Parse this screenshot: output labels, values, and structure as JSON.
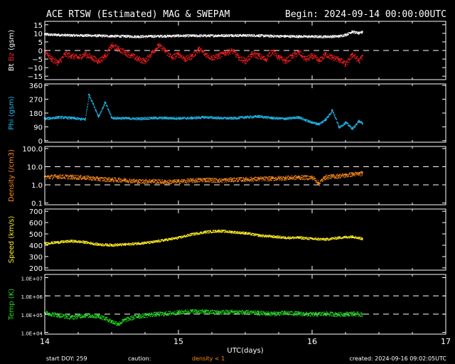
{
  "header": {
    "title": "ACE RTSW (Estimated) MAG & SWEPAM",
    "begin": "Begin: 2024-09-14 00:00:00UTC"
  },
  "footer": {
    "start_doy": "start DOY: 259",
    "caution": "caution:",
    "density_note": "density < 1",
    "created": "created: 2024-09-16 09:02:05UTC"
  },
  "colors": {
    "background": "#000000",
    "frame": "#ffffff",
    "bt": "#ffffff",
    "bz": "#ff2020",
    "phi": "#22bbee",
    "density": "#ff8c1a",
    "speed": "#ffee22",
    "temp": "#22dd22",
    "caution": "#ff8c1a"
  },
  "chart_data": {
    "type": "scatter",
    "x_label": "UTC(days)",
    "x_ticks": [
      "14",
      "15",
      "16",
      "17"
    ],
    "xlim": [
      14,
      17
    ],
    "data_end_day": 16.375,
    "panels": [
      {
        "id": "magfield",
        "ylabel_parts": [
          "Bt",
          "Bz",
          "(gsm)"
        ],
        "scale": "linear",
        "ylim": [
          -17,
          17
        ],
        "ticks": [
          -15,
          -10,
          -5,
          0,
          5,
          10,
          15
        ],
        "tick_labels": [
          "−15",
          "−10",
          "−5",
          "0",
          "5",
          "10",
          "15"
        ],
        "dashed": [
          0
        ],
        "series": [
          {
            "name": "Bt",
            "color": "#ffffff",
            "x": [
              14.0,
              14.1,
              14.2,
              14.3,
              14.4,
              14.5,
              14.6,
              14.7,
              14.8,
              14.9,
              15.0,
              15.1,
              15.2,
              15.3,
              15.4,
              15.5,
              15.6,
              15.7,
              15.8,
              15.9,
              16.0,
              16.1,
              16.2,
              16.25,
              16.3,
              16.35,
              16.375
            ],
            "y": [
              9.5,
              9.3,
              9.0,
              9.0,
              8.8,
              8.6,
              8.5,
              8.3,
              8.5,
              8.6,
              8.8,
              8.8,
              8.8,
              8.9,
              9.0,
              9.0,
              8.9,
              8.6,
              8.5,
              8.4,
              8.3,
              8.3,
              8.5,
              9.4,
              11.2,
              10.2,
              11.0
            ]
          },
          {
            "name": "Bz",
            "color": "#ff2020",
            "x": [
              14.0,
              14.05,
              14.1,
              14.15,
              14.2,
              14.25,
              14.3,
              14.35,
              14.4,
              14.45,
              14.5,
              14.55,
              14.6,
              14.65,
              14.7,
              14.75,
              14.8,
              14.85,
              14.9,
              14.95,
              15.0,
              15.05,
              15.1,
              15.15,
              15.2,
              15.25,
              15.3,
              15.35,
              15.4,
              15.45,
              15.5,
              15.55,
              15.6,
              15.65,
              15.7,
              15.75,
              15.8,
              15.85,
              15.9,
              15.95,
              16.0,
              16.05,
              16.1,
              16.15,
              16.2,
              16.25,
              16.3,
              16.35,
              16.375
            ],
            "y": [
              0,
              -5,
              -7,
              -2,
              -3,
              -4,
              -2,
              -4,
              -6,
              -3,
              3,
              1,
              -1,
              -3,
              -5,
              -6,
              -1,
              3,
              0,
              -4,
              -2,
              -5,
              -3,
              1,
              -2,
              -4,
              -3,
              -1,
              0,
              -4,
              -6,
              -2,
              -3,
              -5,
              0,
              -4,
              -6,
              -3,
              -1,
              -5,
              -3,
              -6,
              -2,
              -4,
              -5,
              -8,
              -2,
              -6,
              -3
            ]
          }
        ]
      },
      {
        "id": "phi",
        "ylabel": "Phi (gsm)",
        "scale": "linear",
        "ylim": [
          -10,
          370
        ],
        "ticks": [
          0,
          90,
          180,
          270,
          360
        ],
        "tick_labels": [
          "0",
          "90",
          "180",
          "270",
          "360"
        ],
        "series": [
          {
            "name": "Phi",
            "color": "#22bbee",
            "x": [
              14.0,
              14.1,
              14.2,
              14.3,
              14.33,
              14.4,
              14.45,
              14.5,
              14.6,
              14.7,
              14.8,
              14.9,
              15.0,
              15.1,
              15.2,
              15.3,
              15.4,
              15.5,
              15.6,
              15.7,
              15.8,
              15.9,
              15.95,
              16.0,
              16.05,
              16.1,
              16.15,
              16.2,
              16.25,
              16.3,
              16.35,
              16.375
            ],
            "y": [
              145,
              155,
              150,
              140,
              300,
              160,
              250,
              150,
              148,
              145,
              150,
              150,
              148,
              150,
              155,
              150,
              148,
              155,
              160,
              150,
              145,
              155,
              135,
              120,
              110,
              140,
              200,
              90,
              120,
              80,
              130,
              115
            ]
          }
        ]
      },
      {
        "id": "density",
        "ylabel": "Density (/cm3)",
        "scale": "log",
        "ylim": [
          0.08,
          130
        ],
        "ticks": [
          0.1,
          1.0,
          10.0,
          100.0
        ],
        "tick_labels": [
          "0.1",
          "1.0",
          "10.0",
          "100.0"
        ],
        "dashed": [
          1.0,
          10.0
        ],
        "series": [
          {
            "name": "Density",
            "color": "#ff8c1a",
            "x": [
              14.0,
              14.1,
              14.2,
              14.3,
              14.4,
              14.5,
              14.6,
              14.7,
              14.8,
              14.9,
              15.0,
              15.1,
              15.2,
              15.3,
              15.4,
              15.5,
              15.6,
              15.7,
              15.8,
              15.9,
              16.0,
              16.05,
              16.1,
              16.15,
              16.2,
              16.25,
              16.3,
              16.35,
              16.375
            ],
            "y": [
              2.8,
              3.0,
              2.8,
              2.6,
              2.2,
              2.0,
              1.9,
              1.6,
              1.7,
              1.5,
              1.6,
              1.8,
              2.0,
              1.8,
              2.0,
              2.1,
              2.2,
              2.3,
              2.5,
              2.7,
              2.6,
              1.2,
              2.8,
              3.0,
              3.2,
              3.5,
              4.0,
              4.2,
              4.5
            ]
          }
        ]
      },
      {
        "id": "speed",
        "ylabel": "Speed (km/s)",
        "scale": "linear",
        "ylim": [
          180,
          720
        ],
        "ticks": [
          200,
          300,
          400,
          500,
          600,
          700
        ],
        "tick_labels": [
          "200",
          "300",
          "400",
          "500",
          "600",
          "700"
        ],
        "series": [
          {
            "name": "Speed",
            "color": "#ffee22",
            "x": [
              14.0,
              14.1,
              14.2,
              14.3,
              14.4,
              14.5,
              14.6,
              14.7,
              14.8,
              14.9,
              15.0,
              15.1,
              15.2,
              15.3,
              15.4,
              15.5,
              15.6,
              15.7,
              15.8,
              15.9,
              16.0,
              16.1,
              16.2,
              16.3,
              16.375
            ],
            "y": [
              420,
              430,
              440,
              430,
              410,
              405,
              410,
              420,
              430,
              450,
              470,
              500,
              520,
              530,
              520,
              510,
              490,
              480,
              470,
              470,
              460,
              455,
              470,
              480,
              460
            ]
          }
        ]
      },
      {
        "id": "temp",
        "ylabel": "Temp (K)",
        "scale": "log",
        "ylim": [
          8000,
          15000000
        ],
        "ticks": [
          10000,
          100000,
          1000000,
          10000000
        ],
        "tick_labels": [
          "1.0E+04",
          "1.0E+05",
          "1.0E+06",
          "1.0E+07"
        ],
        "dashed": [
          100000,
          1000000
        ],
        "series": [
          {
            "name": "Temp",
            "color": "#22dd22",
            "x": [
              14.0,
              14.1,
              14.2,
              14.3,
              14.4,
              14.5,
              14.55,
              14.6,
              14.7,
              14.8,
              14.9,
              15.0,
              15.1,
              15.2,
              15.3,
              15.4,
              15.5,
              15.6,
              15.7,
              15.8,
              15.9,
              16.0,
              16.1,
              16.2,
              16.3,
              16.375
            ],
            "y": [
              120000,
              90000,
              70000,
              90000,
              80000,
              40000,
              30000,
              50000,
              80000,
              100000,
              110000,
              130000,
              150000,
              140000,
              130000,
              140000,
              130000,
              120000,
              110000,
              120000,
              110000,
              100000,
              110000,
              100000,
              110000,
              100000
            ]
          }
        ]
      }
    ]
  }
}
